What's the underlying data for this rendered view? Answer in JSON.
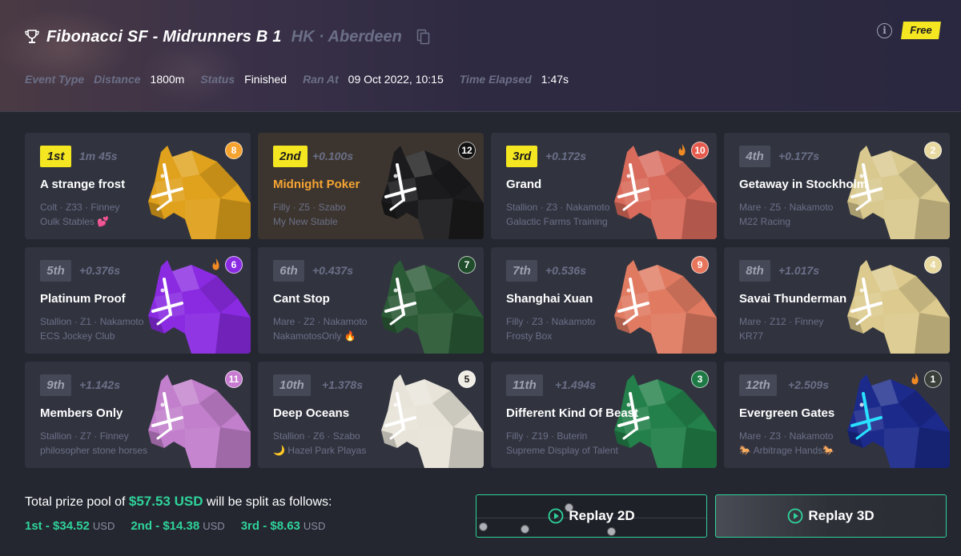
{
  "header": {
    "title": "Fibonacci SF - Midrunners B 1",
    "location": "HK · Aberdeen",
    "free_badge": "Free",
    "meta": [
      {
        "label": "Event Type",
        "value": ""
      },
      {
        "label": "Distance",
        "value": "1800m"
      },
      {
        "label": "Status",
        "value": "Finished"
      },
      {
        "label": "Ran At",
        "value": "09 Oct 2022, 10:15"
      },
      {
        "label": "Time Elapsed",
        "value": "1:47s"
      }
    ]
  },
  "results": [
    {
      "position": "1st",
      "gap": "1m 45s",
      "name": "A strange frost",
      "meta": "Colt · Z33 · Finney",
      "stable": "Oulk Stables 💕",
      "gate": "8",
      "gate_color": "#f5a22e",
      "gate_text": "#ffffff",
      "horse_color": "#e0a11c",
      "bridle": "#ffffff",
      "fire": false,
      "gold": true,
      "highlight": false,
      "name_orange": false
    },
    {
      "position": "2nd",
      "gap": "+0.100s",
      "name": "Midnight Poker",
      "meta": "Filly · Z5 · Szabo",
      "stable": "My New Stable",
      "gate": "12",
      "gate_color": "#111111",
      "gate_text": "#ffffff",
      "horse_color": "#1b1b1d",
      "bridle": "#ffffff",
      "fire": false,
      "gold": true,
      "highlight": true,
      "name_orange": true
    },
    {
      "position": "3rd",
      "gap": "+0.172s",
      "name": "Grand",
      "meta": "Stallion · Z3 · Nakamoto",
      "stable": "Galactic Farms Training",
      "gate": "10",
      "gate_color": "#e55a4c",
      "gate_text": "#ffffff",
      "horse_color": "#d96b5c",
      "bridle": "#ffffff",
      "fire": true,
      "gold": true,
      "highlight": false,
      "name_orange": false
    },
    {
      "position": "4th",
      "gap": "+0.177s",
      "name": "Getaway in Stockholm",
      "meta": "Mare · Z5 · Nakamoto",
      "stable": "M22 Racing",
      "gate": "2",
      "gate_color": "#e8d9a0",
      "gate_text": "#ffffff",
      "horse_color": "#d9c98f",
      "bridle": "#ffffff",
      "fire": false,
      "gold": false,
      "highlight": false,
      "name_orange": false
    },
    {
      "position": "5th",
      "gap": "+0.376s",
      "name": "Platinum Proof",
      "meta": "Stallion · Z1 · Nakamoto",
      "stable": "ECS Jockey Club",
      "gate": "6",
      "gate_color": "#8a2be2",
      "gate_text": "#ffffff",
      "horse_color": "#8a2be2",
      "bridle": "#ffffff",
      "fire": true,
      "gold": false,
      "highlight": false,
      "name_orange": false
    },
    {
      "position": "6th",
      "gap": "+0.437s",
      "name": "Cant Stop",
      "meta": "Mare · Z2 · Nakamoto",
      "stable": "NakamotosOnly 🔥",
      "gate": "7",
      "gate_color": "#1f4d2b",
      "gate_text": "#ffffff",
      "horse_color": "#2b5a36",
      "bridle": "#ffffff",
      "fire": false,
      "gold": false,
      "highlight": false,
      "name_orange": false
    },
    {
      "position": "7th",
      "gap": "+0.536s",
      "name": "Shanghai Xuan",
      "meta": "Filly · Z3 · Nakamoto",
      "stable": "Frosty Box",
      "gate": "9",
      "gate_color": "#e8765c",
      "gate_text": "#ffffff",
      "horse_color": "#e07b62",
      "bridle": "#ffffff",
      "fire": false,
      "gold": false,
      "highlight": false,
      "name_orange": false
    },
    {
      "position": "8th",
      "gap": "+1.017s",
      "name": "Savai Thunderman",
      "meta": "Mare · Z12 · Finney",
      "stable": "KR77",
      "gate": "4",
      "gate_color": "#e8d9a0",
      "gate_text": "#ffffff",
      "horse_color": "#dcca8e",
      "bridle": "#ffffff",
      "fire": false,
      "gold": false,
      "highlight": false,
      "name_orange": false
    },
    {
      "position": "9th",
      "gap": "+1.142s",
      "name": "Members Only",
      "meta": "Stallion · Z7 · Finney",
      "stable": "philosopher stone horses",
      "gate": "11",
      "gate_color": "#c77ad0",
      "gate_text": "#ffffff",
      "horse_color": "#c27fcc",
      "bridle": "#ffffff",
      "fire": false,
      "gold": false,
      "highlight": false,
      "name_orange": false
    },
    {
      "position": "10th",
      "gap": "+1.378s",
      "name": "Deep Oceans",
      "meta": "Stallion · Z6 · Szabo",
      "stable": "🌙 Hazel Park Playas",
      "gate": "5",
      "gate_color": "#f0ede4",
      "gate_text": "#1c1c1c",
      "horse_color": "#e8e4d9",
      "bridle": "#ffffff",
      "fire": false,
      "gold": false,
      "highlight": false,
      "name_orange": false
    },
    {
      "position": "11th",
      "gap": "+1.494s",
      "name": "Different Kind Of Beast",
      "meta": "Filly · Z19 · Buterin",
      "stable": "Supreme Display of Talent",
      "gate": "3",
      "gate_color": "#1d7a44",
      "gate_text": "#ffffff",
      "horse_color": "#23804a",
      "bridle": "#ffffff",
      "fire": false,
      "gold": false,
      "highlight": false,
      "name_orange": false
    },
    {
      "position": "12th",
      "gap": "+2.509s",
      "name": "Evergreen Gates",
      "meta": "Mare · Z3 · Nakamoto",
      "stable": "🐎 Arbitrage Hands🐎",
      "gate": "1",
      "gate_color": "#3a3f3a",
      "gate_text": "#ffffff",
      "horse_color": "#1c2a8c",
      "bridle": "#29e0ff",
      "fire": true,
      "gold": false,
      "highlight": false,
      "name_orange": false
    }
  ],
  "prize": {
    "prefix": "Total prize pool of",
    "total": "$57.53 USD",
    "suffix": "will be split as follows:",
    "splits": [
      {
        "place": "1st - $34.52",
        "unit": "USD"
      },
      {
        "place": "2nd - $14.38",
        "unit": "USD"
      },
      {
        "place": "3rd - $8.63",
        "unit": "USD"
      }
    ]
  },
  "replay": {
    "btn_2d": "Replay 2D",
    "btn_3d": "Replay 3D"
  },
  "colors": {
    "accent_green": "#2fd39a",
    "gold": "#f5e622",
    "background": "#242730",
    "card": "#31343f"
  }
}
